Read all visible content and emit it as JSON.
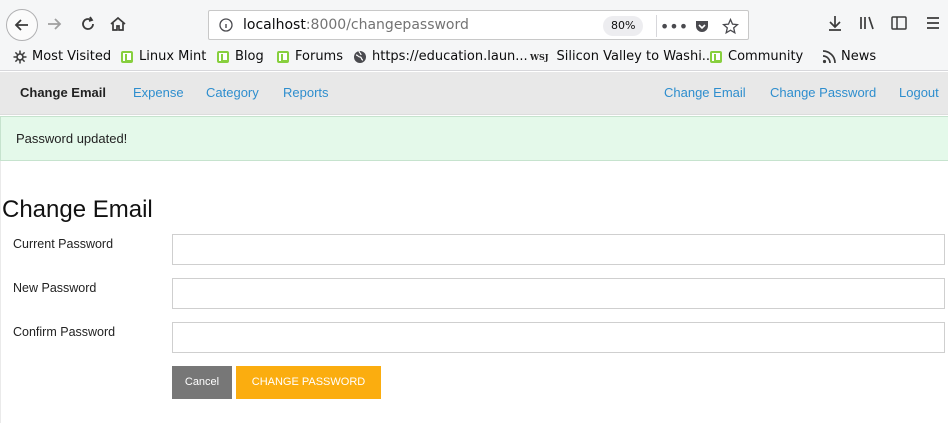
{
  "browser": {
    "url_host": "localhost",
    "url_path": ":8000/changepassword",
    "zoom": "80%",
    "bookmarks": [
      {
        "label": "Most Visited",
        "icon": "gear-icon"
      },
      {
        "label": "Linux Mint",
        "icon": "mint-icon"
      },
      {
        "label": "Blog",
        "icon": "mint-icon"
      },
      {
        "label": "Forums",
        "icon": "mint-icon"
      },
      {
        "label": "https://education.laun...",
        "icon": "globe-icon"
      },
      {
        "label": "Silicon Valley to Washi...",
        "icon": "wsj-icon",
        "icon_text": "WSJ"
      },
      {
        "label": "Community",
        "icon": "mint-icon"
      },
      {
        "label": "News",
        "icon": "rss-icon"
      }
    ]
  },
  "navbar": {
    "brand": "Change Email",
    "left_links": [
      "Expense",
      "Category",
      "Reports"
    ],
    "right_links": [
      "Change Email",
      "Change Password",
      "Logout"
    ]
  },
  "alert": {
    "message": "Password updated!",
    "color": "#e4f9ea"
  },
  "form": {
    "title": "Change Email",
    "fields": [
      {
        "label": "Current Password",
        "value": ""
      },
      {
        "label": "New Password",
        "value": ""
      },
      {
        "label": "Confirm Password",
        "value": ""
      }
    ],
    "cancel_label": "Cancel",
    "submit_label": "CHANGE PASSWORD",
    "submit_color": "#fbad0f",
    "link_color": "#2e8ece"
  }
}
